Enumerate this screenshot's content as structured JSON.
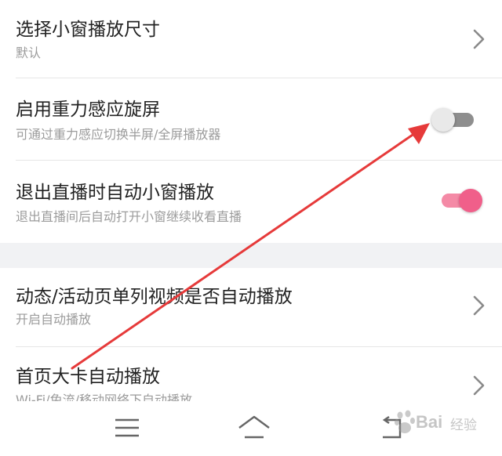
{
  "settings": {
    "items": [
      {
        "title": "选择小窗播放尺寸",
        "subtitle": "默认"
      },
      {
        "title": "启用重力感应旋屏",
        "subtitle": "可通过重力感应切换半屏/全屏播放器",
        "toggle": "off"
      },
      {
        "title": "退出直播时自动小窗播放",
        "subtitle": "退出直播间后自动打开小窗继续收看直播",
        "toggle": "on"
      },
      {
        "title": "动态/活动页单列视频是否自动播放",
        "subtitle": "开启自动播放"
      },
      {
        "title": "首页大卡自动播放",
        "subtitle": "Wi-Fi/免流/移动网络下自动播放"
      }
    ]
  },
  "navbar": {
    "icons": [
      "menu-icon",
      "home-icon",
      "back-icon"
    ]
  },
  "watermark": {
    "brand": "Bai",
    "sub": "经验"
  },
  "colors": {
    "accent": "#f05f8a",
    "annotation_arrow": "#e63a3a",
    "section_gap": "#f1f2f4"
  }
}
